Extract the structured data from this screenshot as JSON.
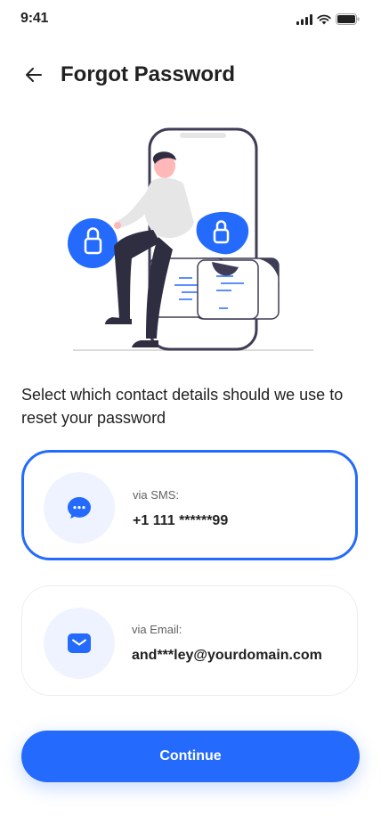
{
  "status_bar": {
    "time": "9:41"
  },
  "header": {
    "title": "Forgot Password",
    "back_icon": "arrow-left-icon"
  },
  "instructions": "Select which contact details should we use to reset your password",
  "options": [
    {
      "label": "via SMS:",
      "value": "+1 111 ******99",
      "icon": "chat-bubble-icon",
      "selected": true
    },
    {
      "label": "via Email:",
      "value": "and***ley@yourdomain.com",
      "icon": "mail-icon",
      "selected": false
    }
  ],
  "continue_label": "Continue",
  "colors": {
    "primary": "#246BFD",
    "icon_bg": "#EEF3FF",
    "text": "#212121"
  }
}
